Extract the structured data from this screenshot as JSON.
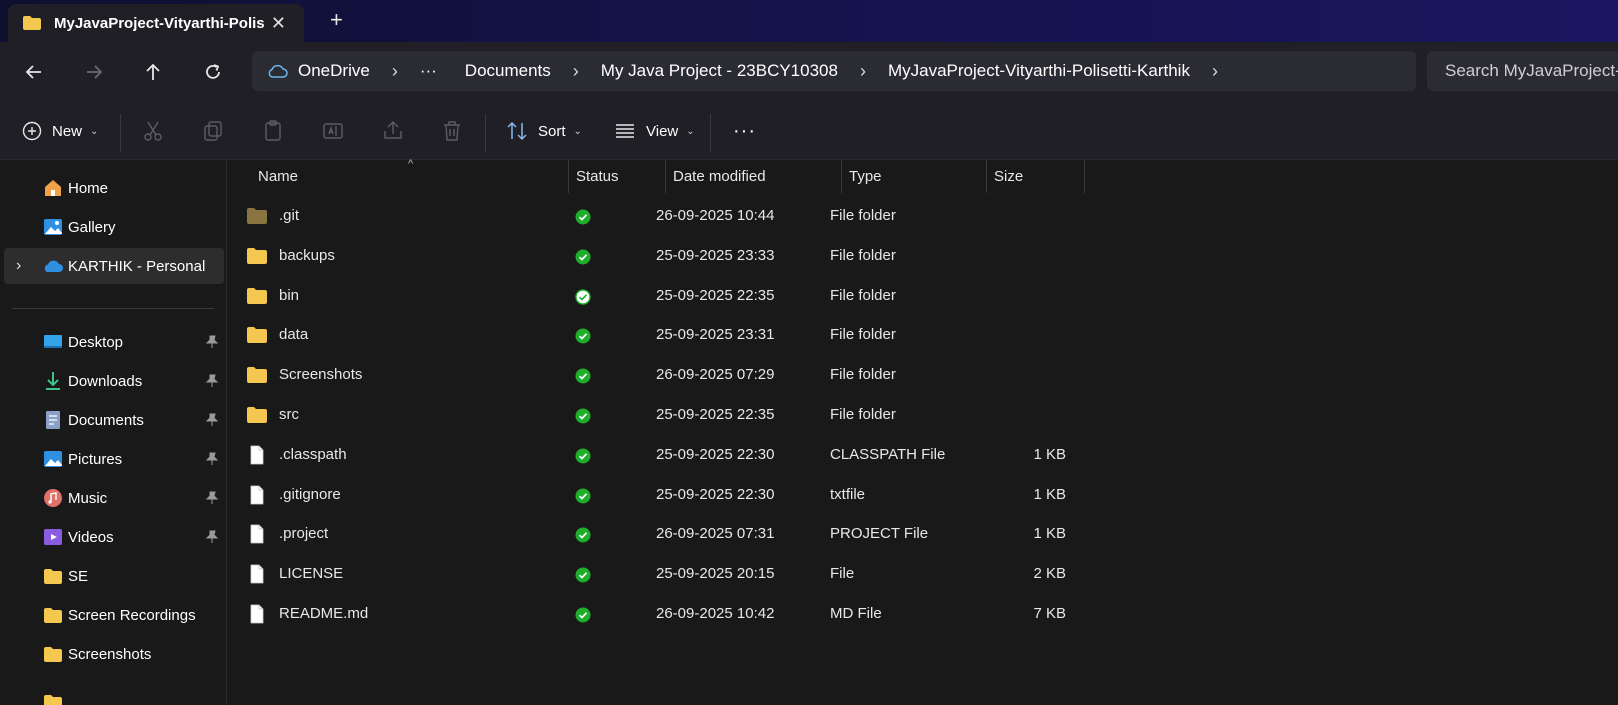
{
  "tab": {
    "title": "MyJavaProject-Vityarthi-Polis",
    "icon": "folder-icon",
    "close": "✕",
    "new_tab": "+"
  },
  "breadcrumb": {
    "root": "OneDrive",
    "ellipsis": "···",
    "items": [
      "Documents",
      "My Java Project - 23BCY10308",
      "MyJavaProject-Vityarthi-Polisetti-Karthik"
    ]
  },
  "search": {
    "placeholder": "Search MyJavaProject-Vityarthi-Polisetti-Karthik"
  },
  "toolbar": {
    "new_label": "New",
    "sort_label": "Sort",
    "view_label": "View",
    "more": "···"
  },
  "sidebar": {
    "top_items": [
      {
        "label": "Home",
        "icon": "home-icon"
      },
      {
        "label": "Gallery",
        "icon": "gallery-icon"
      },
      {
        "label": "KARTHIK - Personal",
        "icon": "onedrive-cloud-icon"
      }
    ],
    "pinned_items": [
      {
        "label": "Desktop",
        "icon": "desktop-icon",
        "color": "#35a3e8"
      },
      {
        "label": "Downloads",
        "icon": "download-icon",
        "color": "#3cc48a"
      },
      {
        "label": "Documents",
        "icon": "document-icon",
        "color": "#8aa0c8"
      },
      {
        "label": "Pictures",
        "icon": "pictures-icon",
        "color": "#2f8fe0"
      },
      {
        "label": "Music",
        "icon": "music-icon",
        "color": "#e0706a"
      },
      {
        "label": "Videos",
        "icon": "videos-icon",
        "color": "#8a5ce0"
      }
    ],
    "folder_items": [
      "SE",
      "Screen Recordings",
      "Screenshots"
    ]
  },
  "columns": {
    "name": "Name",
    "status": "Status",
    "date": "Date modified",
    "type": "Type",
    "size": "Size"
  },
  "files": [
    {
      "name": ".git",
      "kind": "folder-dim",
      "status": "synced",
      "date": "26-09-2025 10:44",
      "type": "File folder",
      "size": ""
    },
    {
      "name": "backups",
      "kind": "folder",
      "status": "synced",
      "date": "25-09-2025 23:33",
      "type": "File folder",
      "size": ""
    },
    {
      "name": "bin",
      "kind": "folder",
      "status": "available",
      "date": "25-09-2025 22:35",
      "type": "File folder",
      "size": ""
    },
    {
      "name": "data",
      "kind": "folder",
      "status": "synced",
      "date": "25-09-2025 23:31",
      "type": "File folder",
      "size": ""
    },
    {
      "name": "Screenshots",
      "kind": "folder",
      "status": "synced",
      "date": "26-09-2025 07:29",
      "type": "File folder",
      "size": ""
    },
    {
      "name": "src",
      "kind": "folder",
      "status": "synced",
      "date": "25-09-2025 22:35",
      "type": "File folder",
      "size": ""
    },
    {
      "name": ".classpath",
      "kind": "file",
      "status": "synced",
      "date": "25-09-2025 22:30",
      "type": "CLASSPATH File",
      "size": "1 KB"
    },
    {
      "name": ".gitignore",
      "kind": "file",
      "status": "synced",
      "date": "25-09-2025 22:30",
      "type": "txtfile",
      "size": "1 KB"
    },
    {
      "name": ".project",
      "kind": "file",
      "status": "synced",
      "date": "26-09-2025 07:31",
      "type": "PROJECT File",
      "size": "1 KB"
    },
    {
      "name": "LICENSE",
      "kind": "file",
      "status": "synced",
      "date": "25-09-2025 20:15",
      "type": "File",
      "size": "2 KB"
    },
    {
      "name": "README.md",
      "kind": "file",
      "status": "synced",
      "date": "26-09-2025 10:42",
      "type": "MD File",
      "size": "7 KB"
    }
  ],
  "colors": {
    "folder": "#f4c84f",
    "folder_dim": "#8a7440",
    "status_green": "#1fae2a",
    "accent": "#4c9be8"
  }
}
